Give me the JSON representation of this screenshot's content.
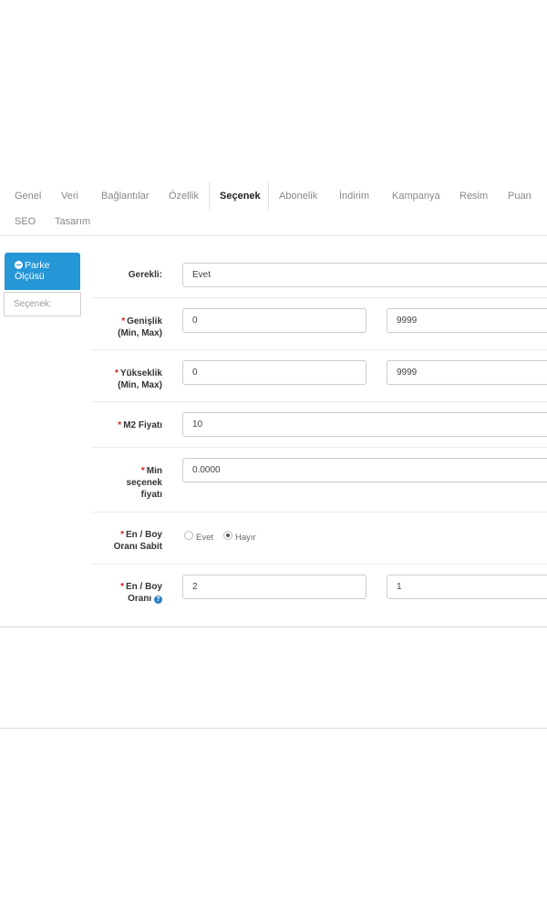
{
  "tabs": {
    "items": [
      {
        "label": "Genel"
      },
      {
        "label": "Veri"
      },
      {
        "label": "Bağlantılar"
      },
      {
        "label": "Özellik"
      },
      {
        "label": "Seçenek"
      },
      {
        "label": "Abonelik"
      },
      {
        "label": "İndirim"
      },
      {
        "label": "Kampanya"
      },
      {
        "label": "Resim"
      },
      {
        "label": "Puan"
      },
      {
        "label": "SEO"
      },
      {
        "label": "Tasarım"
      }
    ],
    "active": "Seçenek"
  },
  "sidebar": {
    "option_button": {
      "line1": "Parke",
      "line2": "Ölçüsü"
    },
    "input_placeholder": "Seçenek:"
  },
  "form": {
    "required_mark": "*",
    "gerekli": {
      "label": "Gerekli:",
      "value": "Evet"
    },
    "genislik": {
      "label_line1": "Genişlik",
      "label_line2": "(Min, Max)",
      "min": "0",
      "max": "9999"
    },
    "yukseklik": {
      "label_line1": "Yükseklik",
      "label_line2": "(Min, Max)",
      "min": "0",
      "max": "9999"
    },
    "m2_fiyati": {
      "label": "M2 Fiyatı",
      "value": "10"
    },
    "min_secenek_fiyati": {
      "label_line1": "Min",
      "label_line2": "seçenek",
      "label_line3": "fiyatı",
      "value": "0.0000"
    },
    "en_boy_orani_sabit": {
      "label_line1": "En / Boy",
      "label_line2": "Oranı Sabit",
      "options": [
        {
          "label": "Evet",
          "checked": false
        },
        {
          "label": "Hayır",
          "checked": true
        }
      ]
    },
    "en_boy_orani": {
      "label_line1": "En / Boy",
      "label_line2": "Oranı",
      "help_icon": "question-circle-icon",
      "value1": "2",
      "value2": "1"
    }
  }
}
